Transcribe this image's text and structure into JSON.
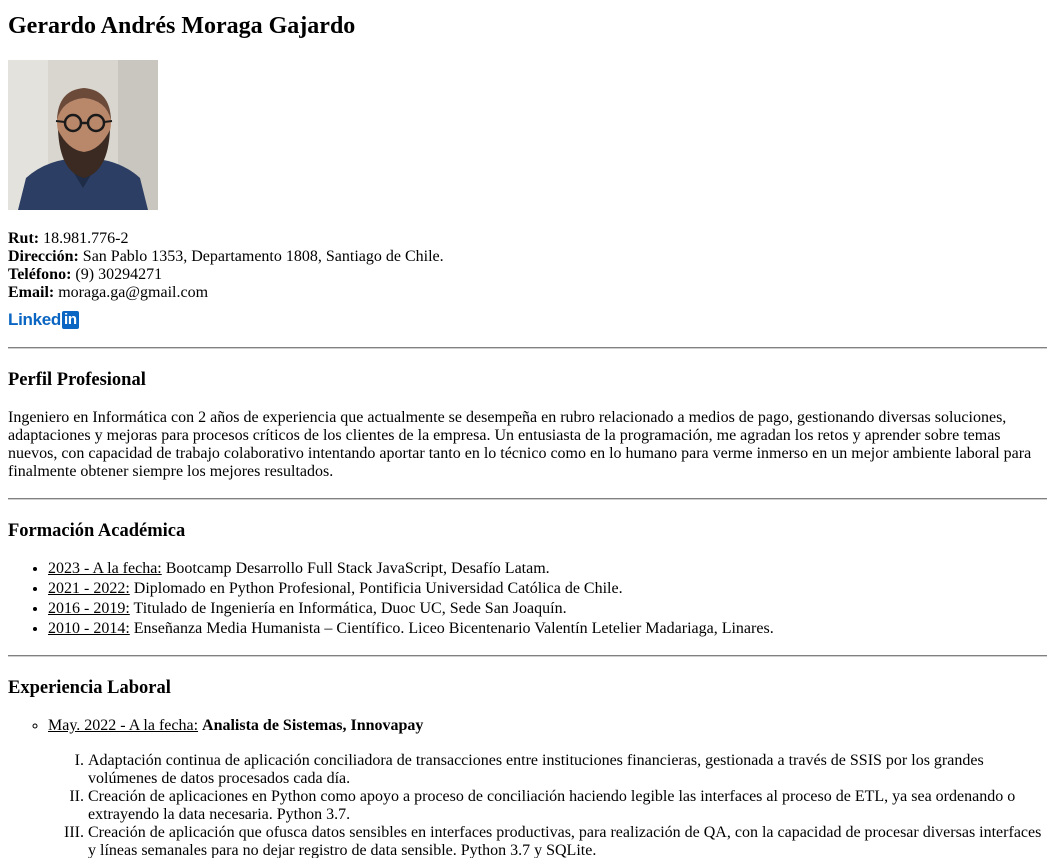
{
  "name": "Gerardo Andrés Moraga Gajardo",
  "contact": {
    "rut_label": "Rut:",
    "rut": "18.981.776-2",
    "address_label": "Dirección:",
    "address": "San Pablo 1353, Departamento 1808, Santiago de Chile.",
    "phone_label": "Teléfono:",
    "phone": "(9) 30294271",
    "email_label": "Email:",
    "email": "moraga.ga@gmail.com",
    "linkedin_text": "Linked",
    "linkedin_in": "in"
  },
  "profile": {
    "heading": "Perfil Profesional",
    "text": "Ingeniero en Informática con 2 años de experiencia que actualmente se desempeña en rubro relacionado a medios de pago, gestionando diversas soluciones, adaptaciones y mejoras para procesos críticos de los clientes de la empresa. Un entusiasta de la programación, me agradan los retos y aprender sobre temas nuevos, con capacidad de trabajo colaborativo intentando aportar tanto en lo técnico como en lo humano para verme inmerso en un mejor ambiente laboral para finalmente obtener siempre los mejores resultados."
  },
  "education": {
    "heading": "Formación Académica",
    "items": [
      {
        "period": "2023 - A la fecha:",
        "text": " Bootcamp Desarrollo Full Stack JavaScript, Desafío Latam."
      },
      {
        "period": "2021 - 2022:",
        "text": " Diplomado en Python Profesional, Pontificia Universidad Católica de Chile."
      },
      {
        "period": "2016 - 2019:",
        "text": " Titulado de Ingeniería en Informática, Duoc UC, Sede San Joaquín."
      },
      {
        "period": "2010 - 2014:",
        "text": " Enseñanza Media Humanista – Científico. Liceo Bicentenario Valentín Letelier Madariaga, Linares."
      }
    ]
  },
  "experience": {
    "heading": "Experiencia Laboral",
    "jobs": [
      {
        "period": "May. 2022 - A la fecha:",
        "title": "Analista de Sistemas, Innovapay",
        "tasks": [
          "Adaptación continua de aplicación conciliadora de transacciones entre instituciones financieras, gestionada a través de SSIS por los grandes volúmenes de datos procesados cada día.",
          "Creación de aplicaciones en Python como apoyo a proceso de conciliación haciendo legible las interfaces al proceso de ETL, ya sea ordenando o extrayendo la data necesaria. Python 3.7.",
          "Creación de aplicación que ofusca datos sensibles en interfaces productivas, para realización de QA, con la capacidad de procesar diversas interfaces y líneas semanales para no dejar registro de data sensible. Python 3.7 y SQLite."
        ]
      }
    ]
  }
}
